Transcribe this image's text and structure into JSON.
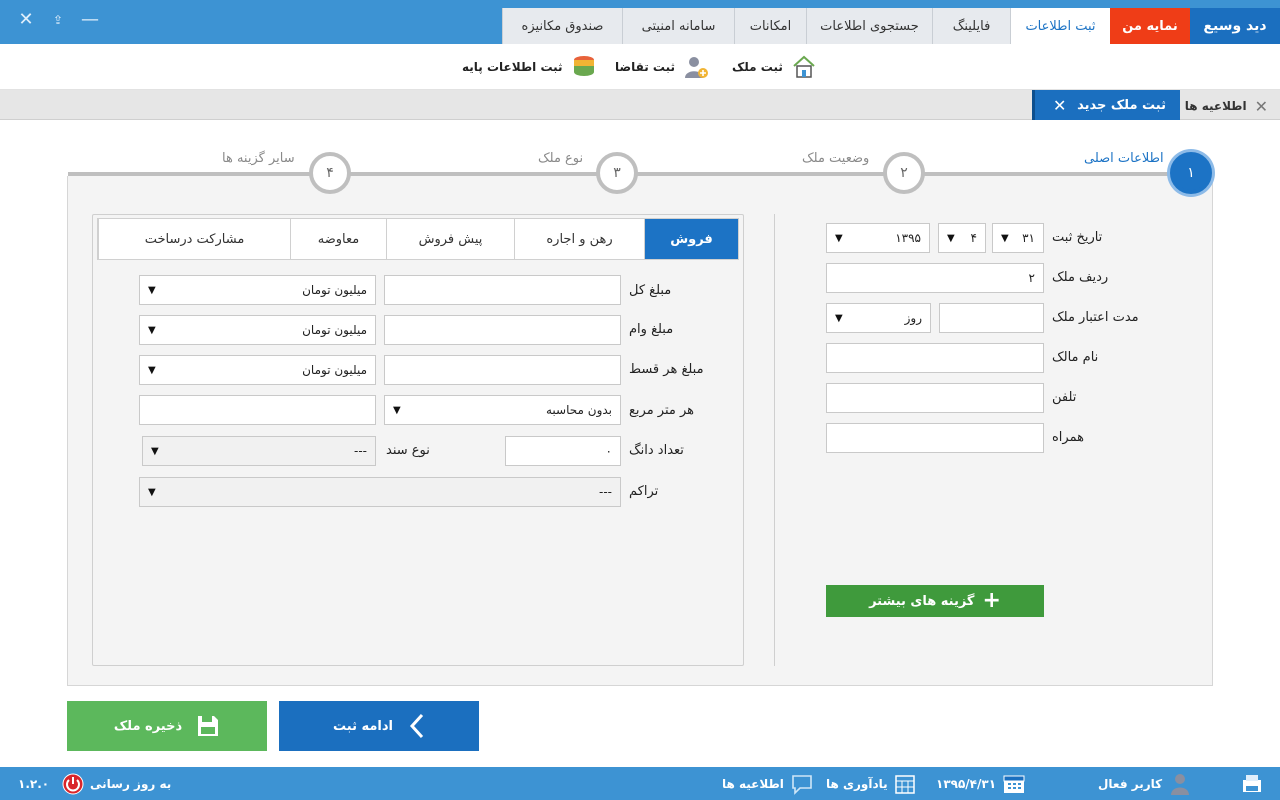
{
  "window": {
    "close": "✕",
    "restore": "⇪",
    "minimize": "—"
  },
  "tabs": [
    {
      "label": "دید وسیع"
    },
    {
      "label": "نمایه من"
    },
    {
      "label": "ثبت اطلاعات"
    },
    {
      "label": "فایلینگ"
    },
    {
      "label": "جستجوی اطلاعات"
    },
    {
      "label": "امکانات"
    },
    {
      "label": "سامانه امنیتی"
    },
    {
      "label": "صندوق مکانیزه"
    }
  ],
  "ribbon": {
    "register_property": "ثبت ملک",
    "register_request": "ثبت تقاضا",
    "register_base": "ثبت اطلاعات پایه"
  },
  "doc_tabs": {
    "news": "اطلاعیه ها",
    "active": "ثبت ملک جدید",
    "close": "✕"
  },
  "steps": [
    {
      "num": "۱",
      "label": "اطلاعات اصلی"
    },
    {
      "num": "۲",
      "label": "وضعیت ملک"
    },
    {
      "num": "۳",
      "label": "نوع ملک"
    },
    {
      "num": "۴",
      "label": "سایر گزینه ها"
    }
  ],
  "main_form": {
    "reg_date_label": "تاریخ ثبت",
    "reg_day": "۳۱",
    "reg_month": "۴",
    "reg_year": "۱۳۹۵",
    "row_label": "ردیف ملک",
    "row_value": "۲",
    "validity_label": "مدت اعتبار ملک",
    "validity_value": "",
    "validity_unit": "روز",
    "owner_label": "نام مالک",
    "owner_value": "",
    "phone_label": "تلفن",
    "phone_value": "",
    "mobile_label": "همراه",
    "mobile_value": "",
    "more_options": "گزینه های بیشتر"
  },
  "deal_tabs": [
    {
      "label": "فروش"
    },
    {
      "label": "رهن و اجاره"
    },
    {
      "label": "پیش فروش"
    },
    {
      "label": "معاوضه"
    },
    {
      "label": "مشارکت درساخت"
    }
  ],
  "sale_form": {
    "total_label": "مبلغ کل",
    "total_value": "",
    "total_unit": "میلیون تومان",
    "loan_label": "مبلغ وام",
    "loan_value": "",
    "loan_unit": "میلیون تومان",
    "installment_label": "مبلغ هر قسط",
    "installment_value": "",
    "installment_unit": "میلیون تومان",
    "per_meter_label": "هر متر مربع",
    "per_meter_mode": "بدون محاسبه",
    "per_meter_value": "",
    "dang_label": "تعداد دانگ",
    "dang_value": "۰",
    "doc_type_label": "نوع سند",
    "doc_type_value": "---",
    "density_label": "تراکم",
    "density_value": "---"
  },
  "buttons": {
    "save": "ذخیره ملک",
    "next": "ادامه ثبت"
  },
  "statusbar": {
    "active_user": "کاربر فعال",
    "date": "۱۳۹۵/۴/۳۱",
    "reminders": "یادآوری ها",
    "notices": "اطلاعیه ها",
    "update": "به روز رسانی",
    "version": "۱.۲.۰"
  },
  "colors": {
    "primary": "#1c73c5",
    "header": "#3d93d3",
    "accent_red": "#ef3d17",
    "success": "#3f9a3c"
  }
}
